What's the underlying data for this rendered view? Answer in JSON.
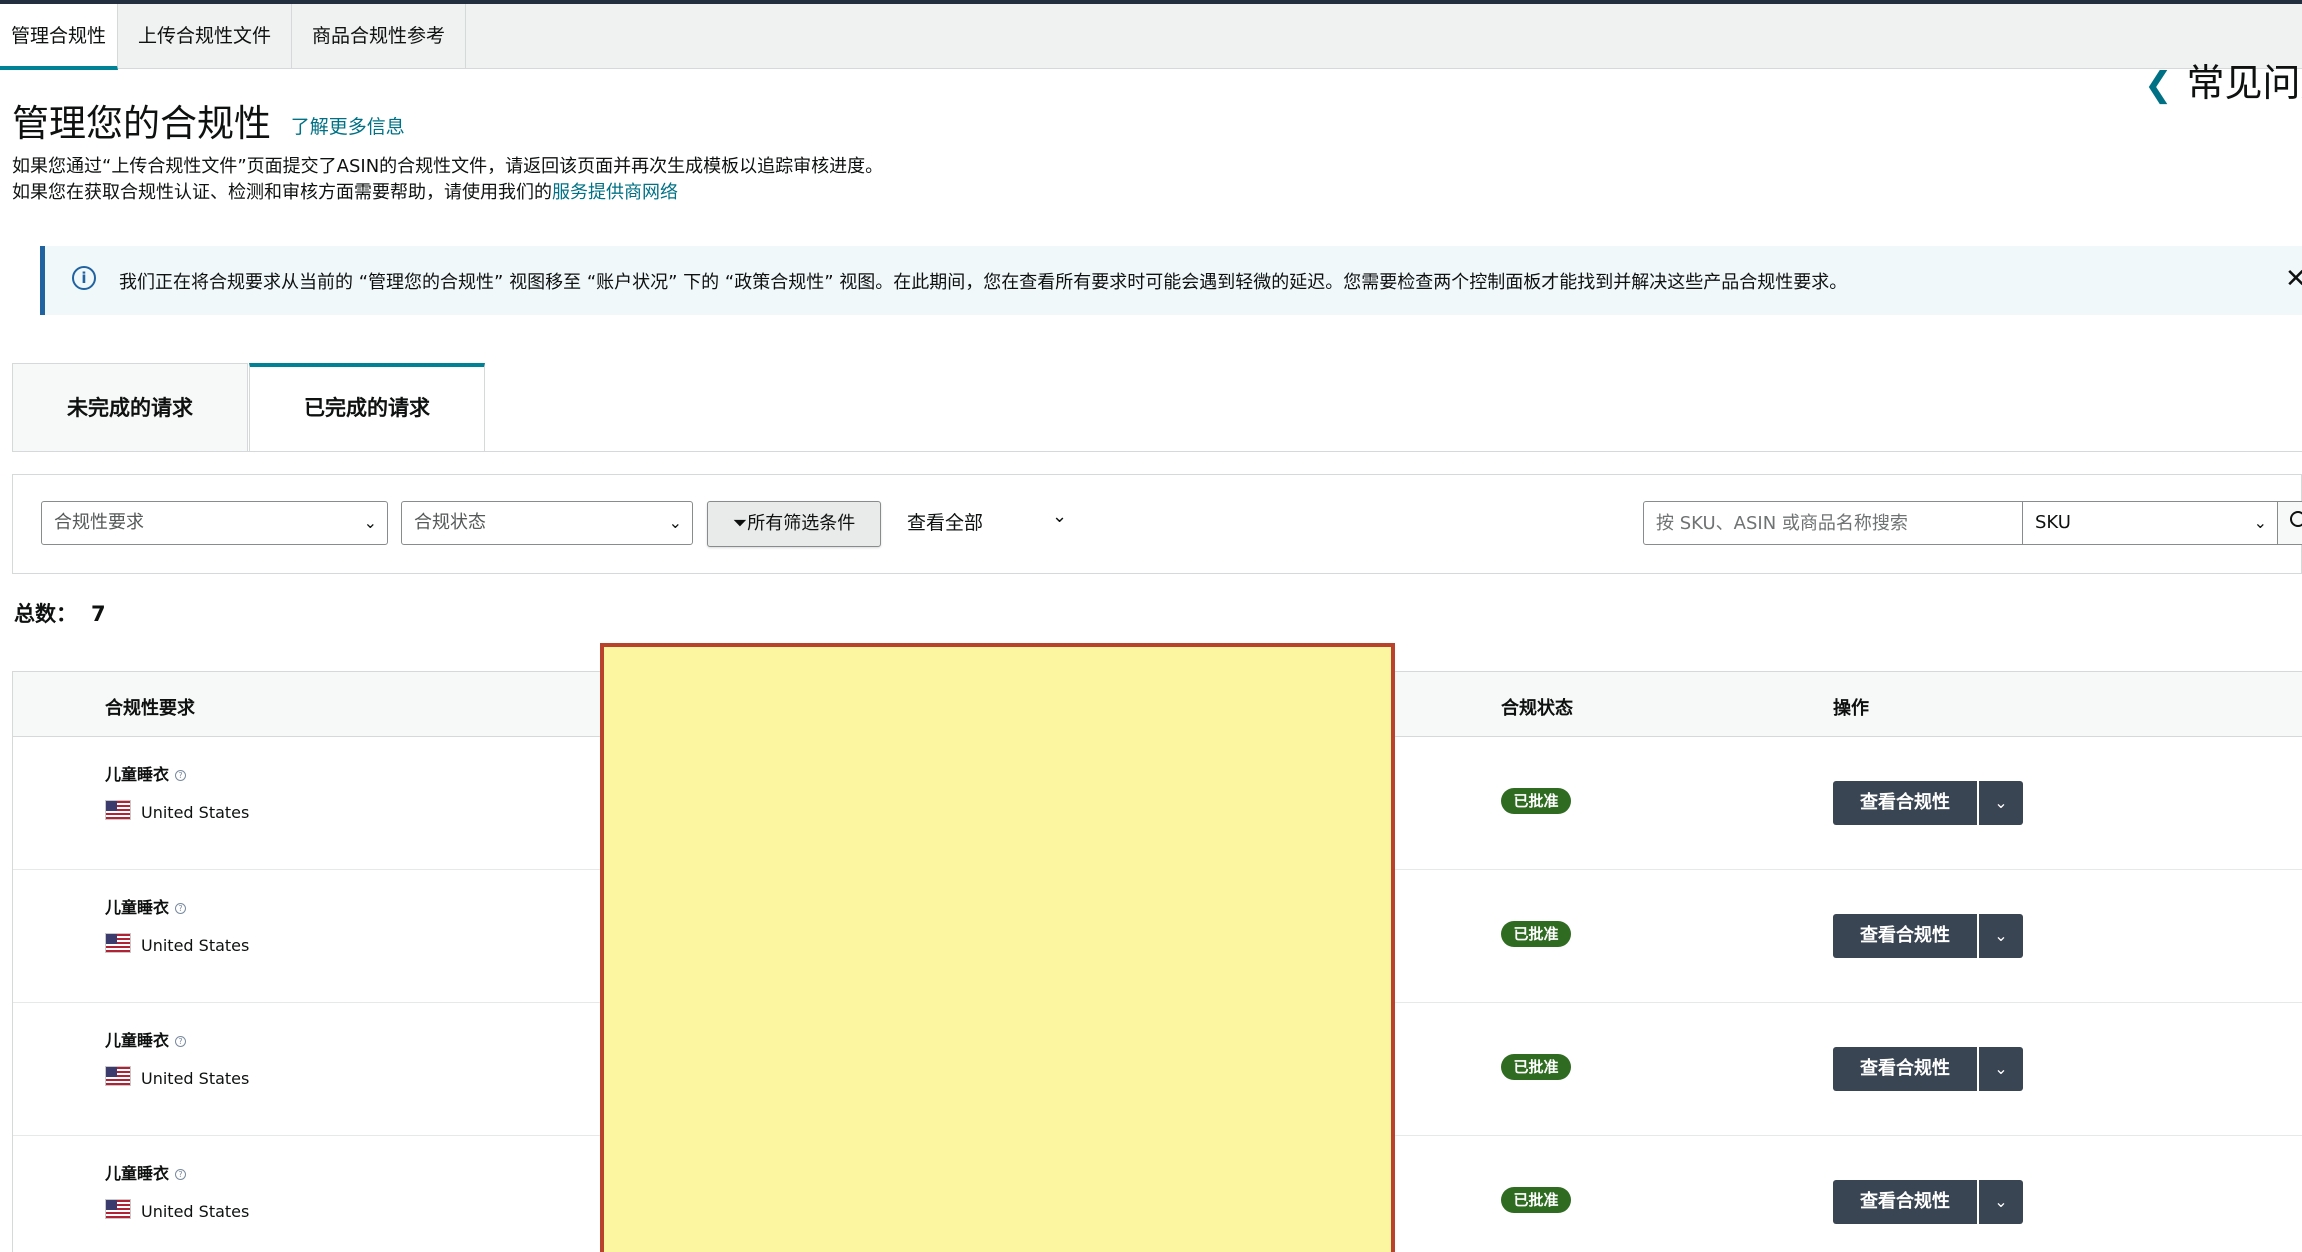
{
  "top_tabs": [
    {
      "label": "管理合规性",
      "active": true
    },
    {
      "label": "上传合规性文件",
      "active": false
    },
    {
      "label": "商品合规性参考",
      "active": false
    }
  ],
  "faq_label": "常见问题",
  "page": {
    "title": "管理您的合规性",
    "learn_more": "了解更多信息",
    "desc_line1": "如果您通过“上传合规性文件”页面提交了ASIN的合规性文件，请返回该页面并再次生成模板以追踪审核进度。",
    "desc_line2_prefix": "如果您在获取合规性认证、检测和审核方面需要帮助，请使用我们的",
    "desc_line2_link": "服务提供商网络"
  },
  "alert": {
    "icon": "info-icon",
    "text": "我们正在将合规要求从当前的 “管理您的合规性” 视图移至 “账户状况” 下的 “政策合规性” 视图。在此期间，您在查看所有要求时可能会遇到轻微的延迟。您需要检查两个控制面板才能找到并解决这些产品合规性要求。",
    "close_icon": "close-icon"
  },
  "sub_tabs": [
    {
      "label": "未完成的请求",
      "active": false
    },
    {
      "label": "已完成的请求",
      "active": true
    }
  ],
  "filters": {
    "requirement_placeholder": "合规性要求",
    "status_placeholder": "合规状态",
    "all_filters_label": "所有筛选条件",
    "view_all_label": "查看全部",
    "search_placeholder": "按 SKU、ASIN 或商品名称搜索",
    "search_type": "SKU"
  },
  "total": {
    "label": "总数：",
    "value": "7"
  },
  "table": {
    "headers": {
      "requirement": "合规性要求",
      "status": "合规状态",
      "action": "操作"
    },
    "rows": [
      {
        "requirement": "儿童睡衣",
        "country": "United States",
        "status": "已批准",
        "action": "查看合规性"
      },
      {
        "requirement": "儿童睡衣",
        "country": "United States",
        "status": "已批准",
        "action": "查看合规性"
      },
      {
        "requirement": "儿童睡衣",
        "country": "United States",
        "status": "已批准",
        "action": "查看合规性"
      },
      {
        "requirement": "儿童睡衣",
        "country": "United States",
        "status": "已批准",
        "action": "查看合规性"
      }
    ]
  },
  "colors": {
    "accent_teal": "#008296",
    "link": "#007185",
    "approved_badge": "#2f6b21",
    "action_button": "#3a4553",
    "redaction_fill": "#fdf6a1",
    "redaction_border": "#b8422b"
  }
}
